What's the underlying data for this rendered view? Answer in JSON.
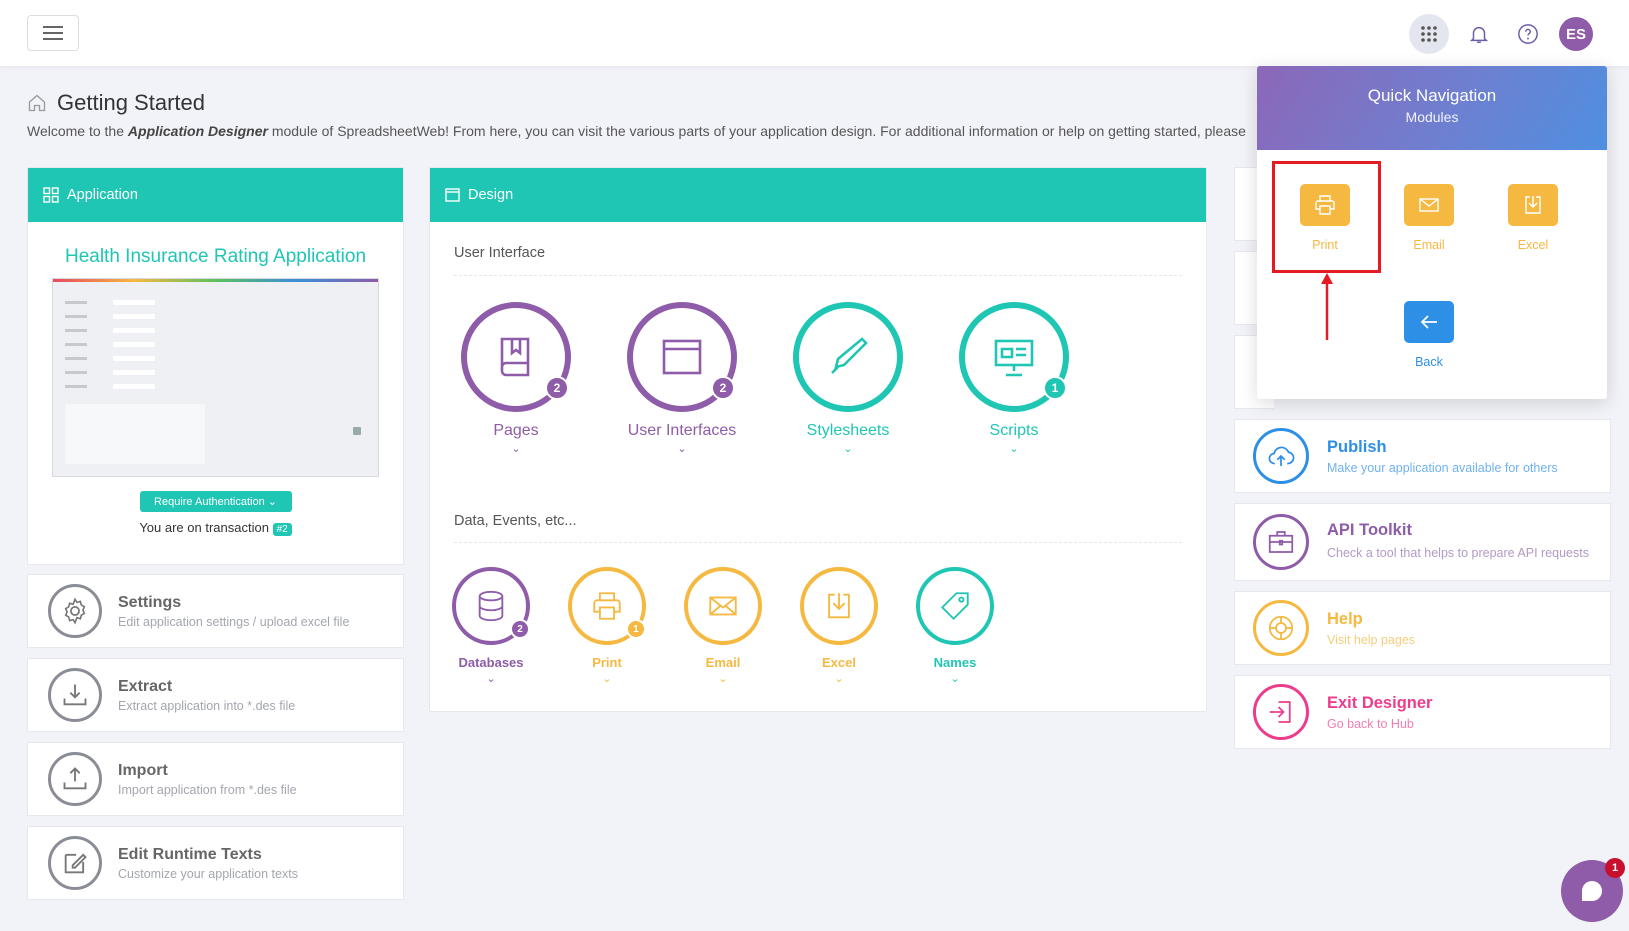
{
  "header": {
    "page_title": "Getting Started",
    "welcome_pre": "Welcome to the ",
    "welcome_module": "Application Designer",
    "welcome_post": " module of SpreadsheetWeb! From here, you can visit the various parts of your application design. For additional information or help on getting started, please",
    "avatar_initials": "ES"
  },
  "application": {
    "card_title": "Application",
    "app_name": "Health Insurance Rating Application",
    "auth_button": "Require Authentication",
    "transaction_text": "You are on transaction",
    "transaction_badge": "#2"
  },
  "tools": [
    {
      "title": "Settings",
      "sub": "Edit application settings / upload excel file",
      "icon": "gear-icon"
    },
    {
      "title": "Extract",
      "sub": "Extract application into *.des file",
      "icon": "download-tray-icon"
    },
    {
      "title": "Import",
      "sub": "Import application from *.des file",
      "icon": "upload-tray-icon"
    },
    {
      "title": "Edit Runtime Texts",
      "sub": "Customize your application texts",
      "icon": "edit-icon"
    }
  ],
  "design": {
    "card_title": "Design",
    "section_ui": "User Interface",
    "section_data": "Data, Events, etc...",
    "ui_items": [
      {
        "label": "Pages",
        "badge": "2",
        "color": "#8e5ca8",
        "icon": "book-icon"
      },
      {
        "label": "User Interfaces",
        "badge": "2",
        "color": "#8e5ca8",
        "icon": "window-icon"
      },
      {
        "label": "Stylesheets",
        "badge": "",
        "color": "#1fc6b4",
        "icon": "pen-icon"
      },
      {
        "label": "Scripts",
        "badge": "1",
        "color": "#1fc6b4",
        "icon": "presentation-icon"
      }
    ],
    "data_items": [
      {
        "label": "Databases",
        "badge": "2",
        "color": "#8e5ca8",
        "icon": "database-icon"
      },
      {
        "label": "Print",
        "badge": "1",
        "color": "#f5b841",
        "icon": "printer-icon"
      },
      {
        "label": "Email",
        "badge": "",
        "color": "#f5b841",
        "icon": "envelope-icon"
      },
      {
        "label": "Excel",
        "badge": "",
        "color": "#f5b841",
        "icon": "download-icon"
      },
      {
        "label": "Names",
        "badge": "",
        "color": "#1fc6b4",
        "icon": "tag-icon"
      }
    ]
  },
  "right_cards": [
    {
      "title": "Publish",
      "sub": "Make your application available for others",
      "color": "#2e8fe6",
      "icon": "cloud-upload-icon"
    },
    {
      "title": "API Toolkit",
      "sub": "Check a tool that helps to prepare API requests",
      "color": "#8e5ca8",
      "icon": "toolbox-icon"
    },
    {
      "title": "Help",
      "sub": "Visit help pages",
      "color": "#f5b841",
      "icon": "lifebuoy-icon"
    },
    {
      "title": "Exit Designer",
      "sub": "Go back to Hub",
      "color": "#ec3d8c",
      "icon": "exit-icon"
    }
  ],
  "quick_nav": {
    "title": "Quick Navigation",
    "subtitle": "Modules",
    "items": [
      {
        "label": "Print",
        "color": "#f5b841",
        "icon": "printer-icon"
      },
      {
        "label": "Email",
        "color": "#f5b841",
        "icon": "envelope-icon"
      },
      {
        "label": "Excel",
        "color": "#f5b841",
        "icon": "download-icon"
      },
      {
        "label": "Back",
        "color": "#2e8fe6",
        "icon": "arrow-left-icon"
      }
    ]
  },
  "chat": {
    "badge": "1"
  }
}
